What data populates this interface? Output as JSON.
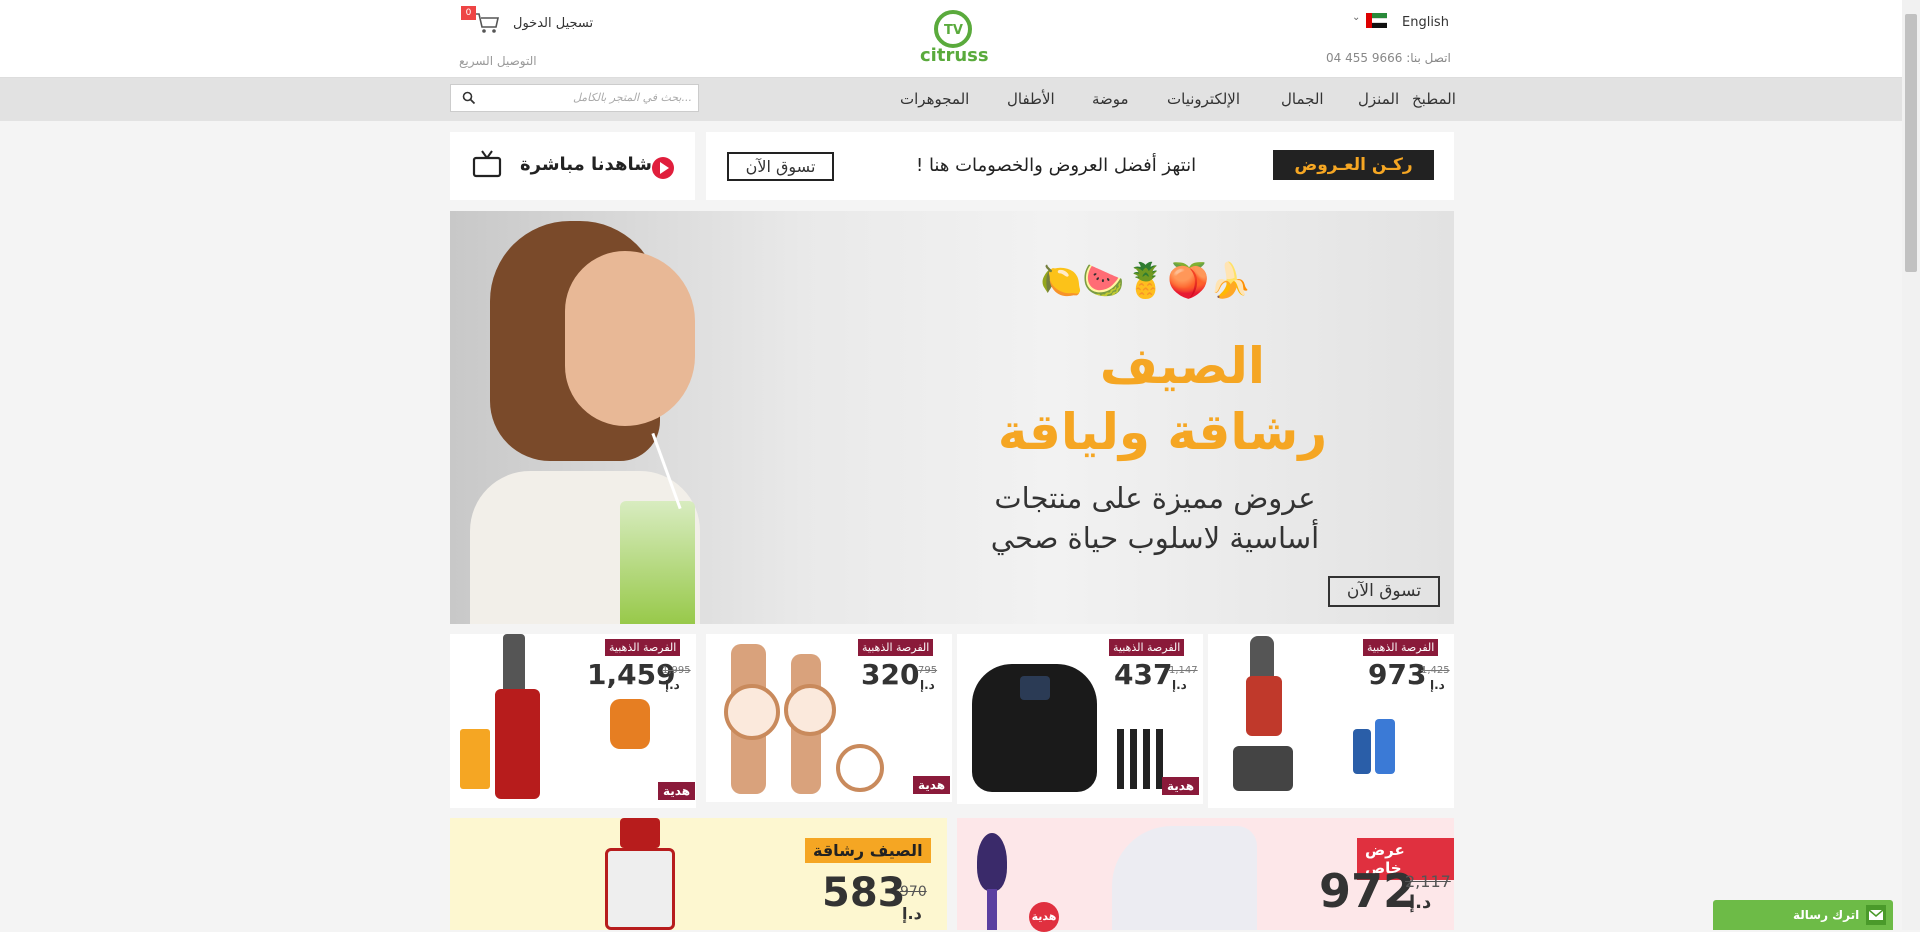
{
  "header": {
    "language": "English",
    "phone": "اتصل بنا: 9666 455 04",
    "login": "تسجيل الدخول",
    "cart_count": "0",
    "fast_delivery": "التوصيل السريع",
    "logo_text": "citruss"
  },
  "nav": {
    "items": [
      "المطبخ",
      "المنزل",
      "الجمال",
      "الإلكترونيات",
      "موضة",
      "الأطفال",
      "المجوهرات"
    ],
    "search_placeholder": "بحث في المتجر بالكامل..."
  },
  "promo": {
    "deals_badge": "ركـن العـروض",
    "deals_text": "انتهز أفضل العروض والخصومات هنا !",
    "shop_now": "تسوق الآن",
    "watch_live": "شاهدنا مباشرة"
  },
  "hero": {
    "title_line1": "الصيف",
    "title_line2": "رشاقة ولياقة",
    "subtitle_line1": "عروض مميزة على منتجات",
    "subtitle_line2": "أساسية لاسلوب حياة صحي",
    "cta": "تسوق الآن"
  },
  "products": [
    {
      "tag": "الفرصة الذهبية",
      "price": "973",
      "old_price": "1,425",
      "currency": "د.إ",
      "product": "vacuum"
    },
    {
      "tag": "الفرصة الذهبية",
      "price": "437",
      "old_price": "1,147",
      "currency": "د.إ",
      "gift": "هدية",
      "product": "airfryer"
    },
    {
      "tag": "الفرصة الذهبية",
      "price": "320",
      "old_price": "795",
      "currency": "د.إ",
      "gift": "هدية",
      "product": "watches"
    },
    {
      "tag": "الفرصة الذهبية",
      "price": "1,459",
      "old_price": "1,995",
      "currency": "د.إ",
      "gift": "هدية",
      "product": "juicer"
    }
  ],
  "bottom": [
    {
      "tag": "عرض خاص",
      "price": "972",
      "old_price": "2,117",
      "currency": "د.إ",
      "gift": "هدية"
    },
    {
      "tag": "الصيف رشاقة",
      "price": "583",
      "old_price": "970",
      "currency": "د.إ"
    }
  ],
  "chat": {
    "label": "اترك رسالة"
  },
  "colors": {
    "brand": "#5aaa3c",
    "gold": "#f5a623",
    "maroon": "#8a1a3a",
    "chat": "#6dbb47"
  }
}
